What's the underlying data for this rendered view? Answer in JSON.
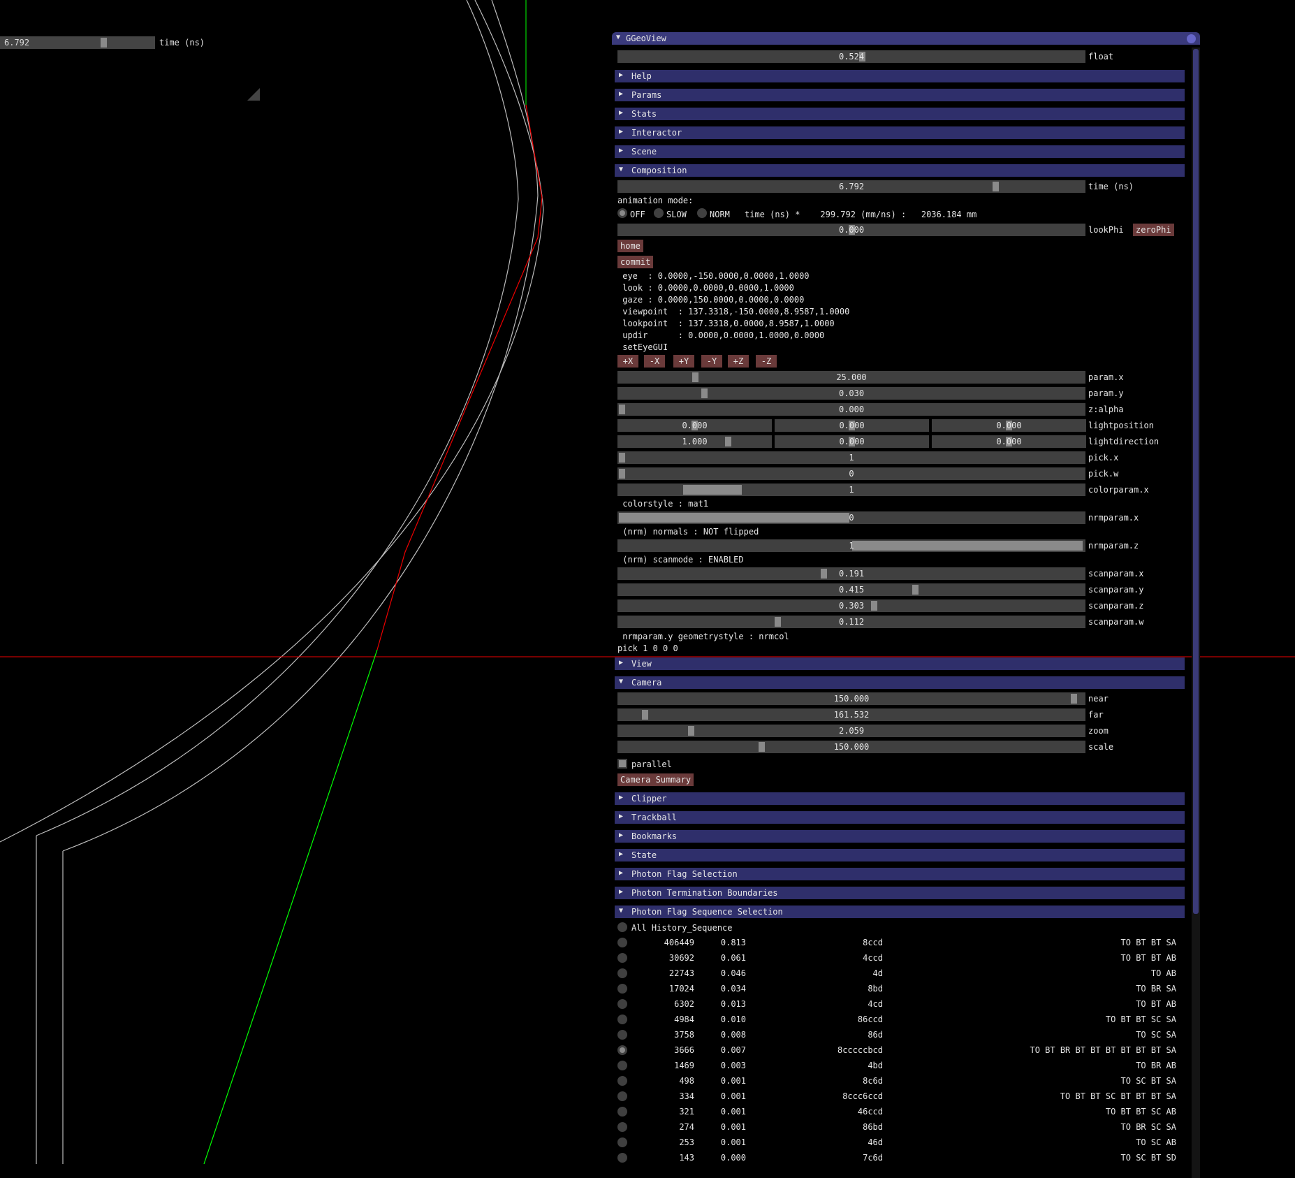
{
  "overlay": {
    "time_value": "6.792",
    "time_label": "time (ns)"
  },
  "window": {
    "title": "GGeoView",
    "float_slider": {
      "value": "0.524",
      "label": "float",
      "fraction": 0.524
    },
    "sections_top": [
      "Help",
      "Params",
      "Stats",
      "Interactor",
      "Scene"
    ],
    "composition": {
      "title": "Composition",
      "time": {
        "value": "6.792",
        "label": "time (ns)"
      },
      "animation_mode_label": "animation mode:",
      "modes": [
        "OFF",
        "SLOW",
        "NORM"
      ],
      "mode_formula": "time (ns) *    299.792 (mm/ns) :   2036.184 mm",
      "lookphi": {
        "value": "0.000",
        "label": "lookPhi",
        "button": "zeroPhi"
      },
      "home_button": "home",
      "commit_button": "commit",
      "info_lines": [
        " eye  : 0.0000,-150.0000,0.0000,1.0000",
        " look : 0.0000,0.0000,0.0000,1.0000",
        " gaze : 0.0000,150.0000,0.0000,0.0000",
        " viewpoint  : 137.3318,-150.0000,8.9587,1.0000",
        " lookpoint  : 137.3318,0.0000,8.9587,1.0000",
        " updir      : 0.0000,0.0000,1.0000,0.0000",
        " setEyeGUI"
      ],
      "eye_buttons": [
        "+X",
        "-X",
        "+Y",
        "-Y",
        "+Z",
        "-Z"
      ],
      "params": [
        {
          "value": "25.000",
          "label": "param.x",
          "fraction": 0.16
        },
        {
          "value": "0.030",
          "label": "param.y",
          "fraction": 0.18
        },
        {
          "value": "0.000",
          "label": "z:alpha",
          "fraction": 0.0
        }
      ],
      "lightposition": {
        "values": [
          "0.000",
          "0.000",
          "0.000"
        ],
        "label": "lightposition"
      },
      "lightdirection": {
        "values": [
          "1.000",
          "0.000",
          "0.000"
        ],
        "label": "lightdirection"
      },
      "pick_x": {
        "value": "1",
        "label": "pick.x",
        "fraction": 0.0
      },
      "pick_w": {
        "value": "0",
        "label": "pick.w",
        "fraction": 0.0
      },
      "colorparam_x": {
        "value": "1",
        "label": "colorparam.x",
        "fraction": 0.14
      },
      "colorstyle_line": " colorstyle : mat1",
      "nrmparam_x": {
        "value": "0",
        "label": "nrmparam.x",
        "fraction": 0.5
      },
      "normals_line": " (nrm) normals : NOT flipped",
      "nrmparam_z": {
        "value": "1",
        "label": "nrmparam.z",
        "fraction": 0.5
      },
      "scanmode_line": " (nrm) scanmode : ENABLED",
      "scanparams": [
        {
          "value": "0.191",
          "label": "scanparam.x",
          "fraction": 0.44
        },
        {
          "value": "0.415",
          "label": "scanparam.y",
          "fraction": 0.64
        },
        {
          "value": "0.303",
          "label": "scanparam.z",
          "fraction": 0.55
        },
        {
          "value": "0.112",
          "label": "scanparam.w",
          "fraction": 0.34
        }
      ],
      "geometrystyle_line": " nrmparam.y geometrystyle : nrmcol",
      "pick_line": "pick 1 0 0 0"
    },
    "view_section": "View",
    "camera": {
      "title": "Camera",
      "sliders": [
        {
          "value": "150.000",
          "label": "near",
          "fraction": 0.985
        },
        {
          "value": "161.532",
          "label": "far",
          "fraction": 0.05
        },
        {
          "value": "2.059",
          "label": "zoom",
          "fraction": 0.15
        },
        {
          "value": "150.000",
          "label": "scale",
          "fraction": 0.305
        }
      ],
      "parallel_label": "parallel",
      "summary_button": "Camera Summary"
    },
    "sections_mid": [
      "Clipper",
      "Trackball",
      "Bookmarks",
      "State"
    ],
    "sections_photon": [
      "Photon Flag Selection",
      "Photon Termination Boundaries"
    ],
    "sequence": {
      "title": "Photon Flag Sequence Selection",
      "all_label": "All History_Sequence",
      "rows": [
        {
          "count": "406449",
          "frac": "0.813",
          "hex": "8ccd",
          "hist": "TO BT BT SA"
        },
        {
          "count": "30692",
          "frac": "0.061",
          "hex": "4ccd",
          "hist": "TO BT BT AB"
        },
        {
          "count": "22743",
          "frac": "0.046",
          "hex": "4d",
          "hist": "TO AB"
        },
        {
          "count": "17024",
          "frac": "0.034",
          "hex": "8bd",
          "hist": "TO BR SA"
        },
        {
          "count": "6302",
          "frac": "0.013",
          "hex": "4cd",
          "hist": "TO BT AB"
        },
        {
          "count": "4984",
          "frac": "0.010",
          "hex": "86ccd",
          "hist": "TO BT BT SC SA"
        },
        {
          "count": "3758",
          "frac": "0.008",
          "hex": "86d",
          "hist": "TO SC SA"
        },
        {
          "count": "3666",
          "frac": "0.007",
          "hex": "8cccccbcd",
          "hist": "TO BT BR BT BT BT BT BT BT SA"
        },
        {
          "count": "1469",
          "frac": "0.003",
          "hex": "4bd",
          "hist": "TO BR AB"
        },
        {
          "count": "498",
          "frac": "0.001",
          "hex": "8c6d",
          "hist": "TO SC BT SA"
        },
        {
          "count": "334",
          "frac": "0.001",
          "hex": "8ccc6ccd",
          "hist": "TO BT BT SC BT BT BT SA"
        },
        {
          "count": "321",
          "frac": "0.001",
          "hex": "46ccd",
          "hist": "TO BT BT SC AB"
        },
        {
          "count": "274",
          "frac": "0.001",
          "hex": "86bd",
          "hist": "TO BR SC SA"
        },
        {
          "count": "253",
          "frac": "0.001",
          "hex": "46d",
          "hist": "TO SC AB"
        },
        {
          "count": "143",
          "frac": "0.000",
          "hex": "7c6d",
          "hist": "TO SC BT SD"
        }
      ]
    }
  }
}
